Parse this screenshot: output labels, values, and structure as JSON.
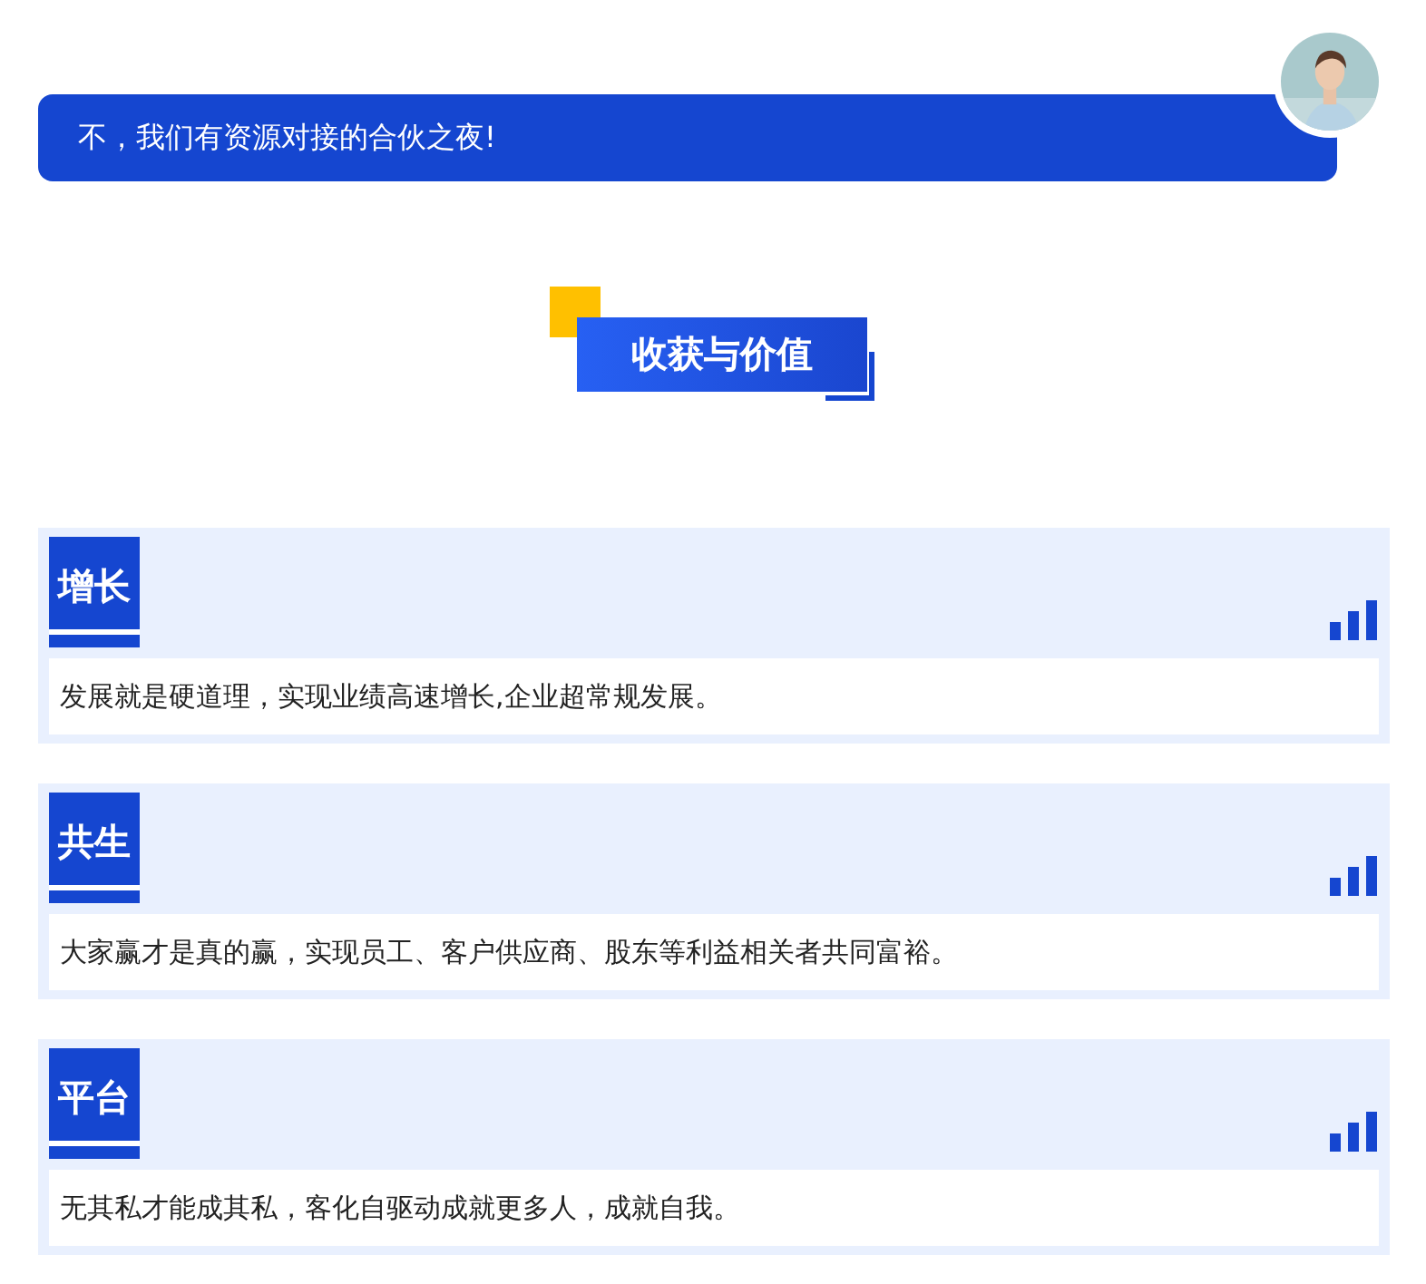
{
  "banner": {
    "text": "不，我们有资源对接的合伙之夜!"
  },
  "section_title": "收获与价值",
  "cards": [
    {
      "tag": "增长",
      "text": "发展就是硬道理，实现业绩高速增长,企业超常规发展。"
    },
    {
      "tag": "共生",
      "text": "大家赢才是真的赢，实现员工、客户供应商、股东等利益相关者共同富裕。"
    },
    {
      "tag": "平台",
      "text": "无其私才能成其私，客化自驱动成就更多人，成就自我。"
    }
  ]
}
